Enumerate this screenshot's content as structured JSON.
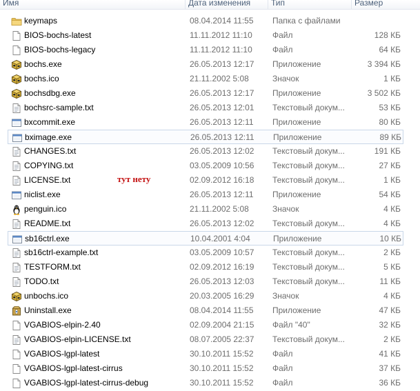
{
  "columns": {
    "name": "Имя",
    "date": "Дата изменения",
    "type": "Тип",
    "size": "Размер"
  },
  "files": [
    {
      "name": "keymaps",
      "date": "08.04.2014 11:55",
      "type": "Папка с файлами",
      "size": "",
      "icon": "folder-icon"
    },
    {
      "name": "BIOS-bochs-latest",
      "date": "11.11.2012 11:10",
      "type": "Файл",
      "size": "128 КБ",
      "icon": "file-icon"
    },
    {
      "name": "BIOS-bochs-legacy",
      "date": "11.11.2012 11:10",
      "type": "Файл",
      "size": "64 КБ",
      "icon": "file-icon"
    },
    {
      "name": "bochs.exe",
      "date": "26.05.2013 12:17",
      "type": "Приложение",
      "size": "3 394 КБ",
      "icon": "bochs-app-icon"
    },
    {
      "name": "bochs.ico",
      "date": "21.11.2002 5:08",
      "type": "Значок",
      "size": "1 КБ",
      "icon": "bochs-app-icon"
    },
    {
      "name": "bochsdbg.exe",
      "date": "26.05.2013 12:17",
      "type": "Приложение",
      "size": "3 502 КБ",
      "icon": "bochs-app-icon"
    },
    {
      "name": "bochsrc-sample.txt",
      "date": "26.05.2013 12:01",
      "type": "Текстовый докум...",
      "size": "53 КБ",
      "icon": "text-file-icon"
    },
    {
      "name": "bxcommit.exe",
      "date": "26.05.2013 12:11",
      "type": "Приложение",
      "size": "80 КБ",
      "icon": "exe-window-icon"
    },
    {
      "name": "bximage.exe",
      "date": "26.05.2013 12:11",
      "type": "Приложение",
      "size": "89 КБ",
      "icon": "exe-window-icon",
      "boxed": true
    },
    {
      "name": "CHANGES.txt",
      "date": "26.05.2013 12:02",
      "type": "Текстовый докум...",
      "size": "191 КБ",
      "icon": "text-file-icon"
    },
    {
      "name": "COPYING.txt",
      "date": "03.05.2009 10:56",
      "type": "Текстовый докум...",
      "size": "27 КБ",
      "icon": "text-file-icon"
    },
    {
      "name": "LICENSE.txt",
      "date": "02.09.2012 16:18",
      "type": "Текстовый докум...",
      "size": "1 КБ",
      "icon": "text-file-icon"
    },
    {
      "name": "niclist.exe",
      "date": "26.05.2013 12:11",
      "type": "Приложение",
      "size": "54 КБ",
      "icon": "exe-window-icon"
    },
    {
      "name": "penguin.ico",
      "date": "21.11.2002 5:08",
      "type": "Значок",
      "size": "4 КБ",
      "icon": "penguin-icon"
    },
    {
      "name": "README.txt",
      "date": "26.05.2013 12:02",
      "type": "Текстовый докум...",
      "size": "4 КБ",
      "icon": "text-file-icon"
    },
    {
      "name": "sb16ctrl.exe",
      "date": "10.04.2001 4:04",
      "type": "Приложение",
      "size": "10 КБ",
      "icon": "exe-window-icon",
      "boxed": true
    },
    {
      "name": "sb16ctrl-example.txt",
      "date": "03.05.2009 10:57",
      "type": "Текстовый докум...",
      "size": "2 КБ",
      "icon": "text-file-icon"
    },
    {
      "name": "TESTFORM.txt",
      "date": "02.09.2012 16:19",
      "type": "Текстовый докум...",
      "size": "5 КБ",
      "icon": "text-file-icon"
    },
    {
      "name": "TODO.txt",
      "date": "26.05.2013 12:03",
      "type": "Текстовый докум...",
      "size": "11 КБ",
      "icon": "text-file-icon"
    },
    {
      "name": "unbochs.ico",
      "date": "20.03.2005 16:29",
      "type": "Значок",
      "size": "4 КБ",
      "icon": "bochs-app-icon"
    },
    {
      "name": "Uninstall.exe",
      "date": "08.04.2014 11:55",
      "type": "Приложение",
      "size": "47 КБ",
      "icon": "installer-icon"
    },
    {
      "name": "VGABIOS-elpin-2.40",
      "date": "02.09.2004 21:15",
      "type": "Файл \"40\"",
      "size": "32 КБ",
      "icon": "file-icon"
    },
    {
      "name": "VGABIOS-elpin-LICENSE.txt",
      "date": "08.07.2005 22:37",
      "type": "Текстовый докум...",
      "size": "2 КБ",
      "icon": "text-file-icon"
    },
    {
      "name": "VGABIOS-lgpl-latest",
      "date": "30.10.2011 15:52",
      "type": "Файл",
      "size": "41 КБ",
      "icon": "file-icon"
    },
    {
      "name": "VGABIOS-lgpl-latest-cirrus",
      "date": "30.10.2011 15:52",
      "type": "Файл",
      "size": "37 КБ",
      "icon": "file-icon"
    },
    {
      "name": "VGABIOS-lgpl-latest-cirrus-debug",
      "date": "30.10.2011 15:52",
      "type": "Файл",
      "size": "36 КБ",
      "icon": "file-icon"
    }
  ],
  "annotation": "тут нету"
}
